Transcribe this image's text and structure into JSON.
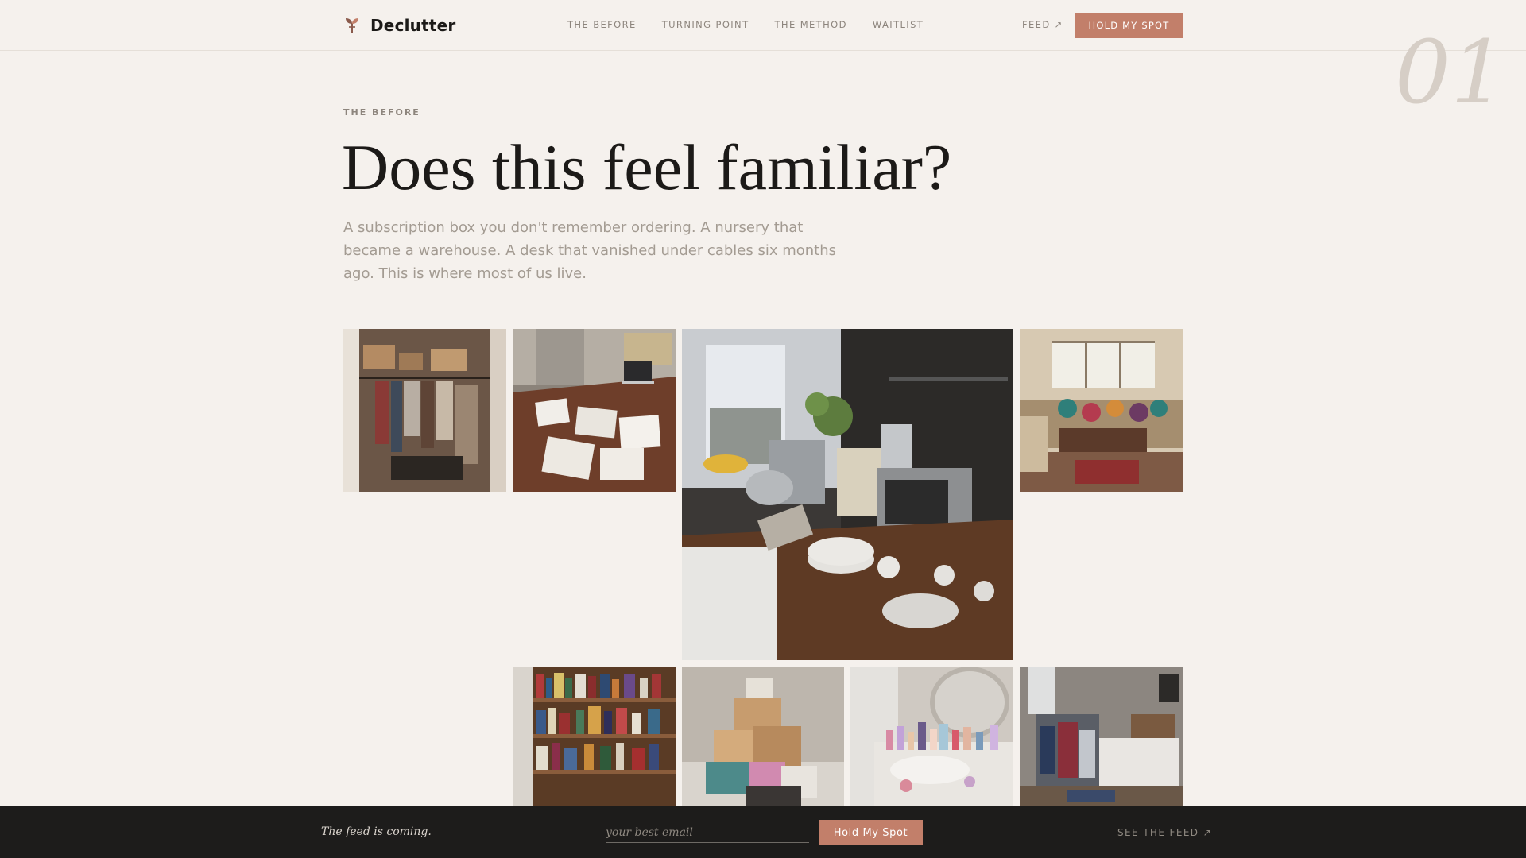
{
  "brand": {
    "name": "Declutter",
    "icon": "seedling-icon"
  },
  "nav": {
    "items": [
      {
        "label": "THE BEFORE"
      },
      {
        "label": "TURNING POINT"
      },
      {
        "label": "THE METHOD"
      },
      {
        "label": "WAITLIST"
      }
    ],
    "feed_label": "FEED ↗",
    "cta_label": "HOLD MY SPOT"
  },
  "hero": {
    "section_number": "01",
    "eyebrow": "THE BEFORE",
    "headline": "Does this feel familiar?",
    "lede": "A subscription box you don't remember ordering. A nursery that became a warehouse. A desk that vanished under cables six months ago. This is where most of us live."
  },
  "gallery": {
    "photos": [
      {
        "subject": "cluttered closet with boxes and hanging clothes"
      },
      {
        "subject": "desk buried under papers and laptop"
      },
      {
        "subject": "kitchen counter crowded with appliances and dishes"
      },
      {
        "subject": "living room full of furniture and cushions"
      },
      {
        "subject": "overfilled wooden bookshelf"
      },
      {
        "subject": "stack of delivery boxes"
      },
      {
        "subject": "bathroom vanity covered in products"
      },
      {
        "subject": "bedroom with clothes piled on chair"
      }
    ]
  },
  "footer_bar": {
    "tagline": "The feed is coming.",
    "email_placeholder": "your best email",
    "cta_label": "Hold My Spot",
    "see_feed_label": "SEE THE FEED ↗"
  },
  "colors": {
    "background": "#f5f1ed",
    "accent": "#c27f6a",
    "text": "#1c1a18",
    "muted": "#a39b92",
    "bar": "#1d1c1b"
  }
}
